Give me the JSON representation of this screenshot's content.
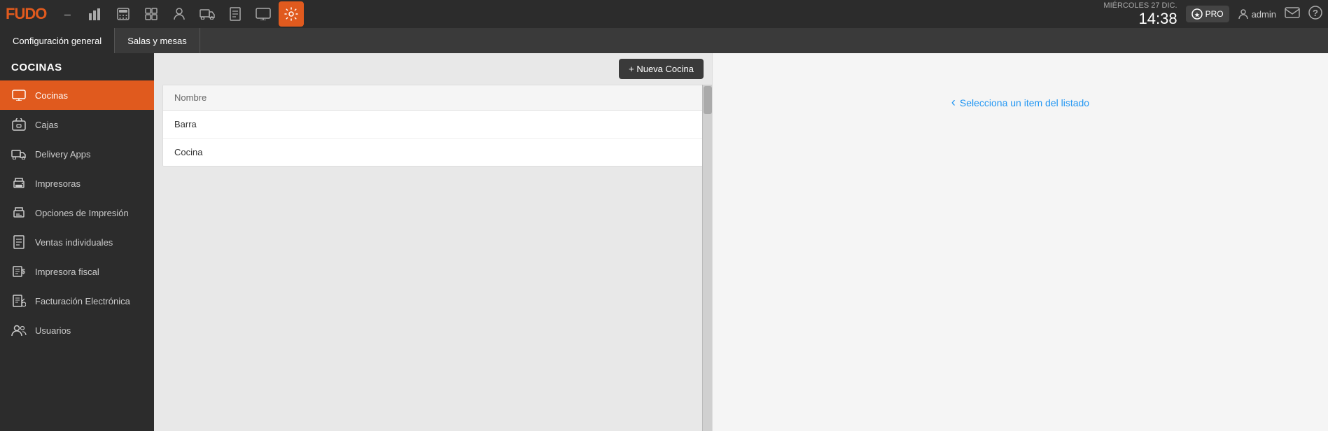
{
  "topnav": {
    "logo": "FUDO",
    "icons": [
      {
        "name": "utensils-icon",
        "symbol": "🍴",
        "active": false
      },
      {
        "name": "chart-icon",
        "symbol": "📊",
        "active": false
      },
      {
        "name": "calculator-icon",
        "symbol": "🧮",
        "active": false
      },
      {
        "name": "grid-icon",
        "symbol": "⊞",
        "active": false
      },
      {
        "name": "user-icon",
        "symbol": "👤",
        "active": false
      },
      {
        "name": "truck-icon",
        "symbol": "🚚",
        "active": false
      },
      {
        "name": "document-icon",
        "symbol": "📄",
        "active": false
      },
      {
        "name": "monitor-icon",
        "symbol": "🖥",
        "active": false
      },
      {
        "name": "settings-icon",
        "symbol": "⚙",
        "active": true
      }
    ],
    "date_label": "MIÉRCOLES 27 DIC.",
    "time": "14:38",
    "pro_label": "PRO",
    "admin_label": "admin"
  },
  "tabbar": {
    "tabs": [
      {
        "label": "Configuración general",
        "active": true
      },
      {
        "label": "Salas y mesas",
        "active": false
      }
    ]
  },
  "sidebar": {
    "title": "COCINAS",
    "items": [
      {
        "label": "Cocinas",
        "icon": "monitor-small-icon",
        "active": true
      },
      {
        "label": "Cajas",
        "icon": "cash-register-icon",
        "active": false
      },
      {
        "label": "Delivery Apps",
        "icon": "delivery-icon",
        "active": false
      },
      {
        "label": "Impresoras",
        "icon": "printer-icon",
        "active": false
      },
      {
        "label": "Opciones de Impresión",
        "icon": "print-options-icon",
        "active": false
      },
      {
        "label": "Ventas individuales",
        "icon": "sales-icon",
        "active": false
      },
      {
        "label": "Impresora fiscal",
        "icon": "fiscal-printer-icon",
        "active": false
      },
      {
        "label": "Facturación Electrónica",
        "icon": "invoice-icon",
        "active": false
      },
      {
        "label": "Usuarios",
        "icon": "users-icon",
        "active": false
      }
    ]
  },
  "content": {
    "new_button_label": "+ Nueva Cocina",
    "table": {
      "header": "Nombre",
      "rows": [
        {
          "name": "Barra"
        },
        {
          "name": "Cocina"
        }
      ]
    }
  },
  "detail": {
    "placeholder": "Selecciona un item del listado"
  }
}
